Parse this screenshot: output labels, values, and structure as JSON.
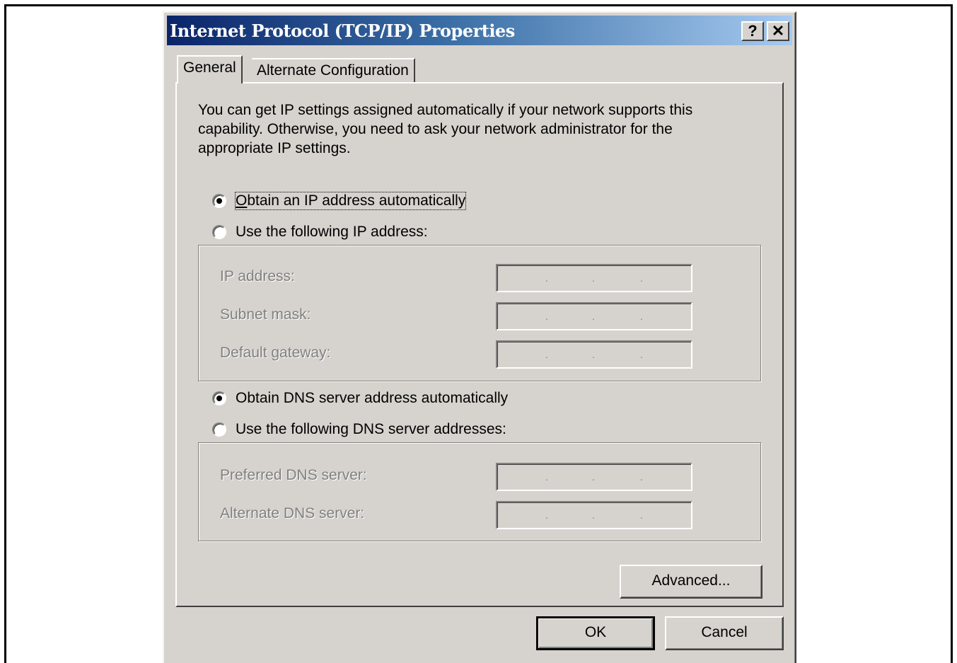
{
  "window": {
    "title": "Internet Protocol (TCP/IP) Properties",
    "help_button": "?",
    "close_button": "✕"
  },
  "tabs": [
    {
      "label": "General",
      "selected": true
    },
    {
      "label": "Alternate Configuration",
      "selected": false
    }
  ],
  "intro_text": "You can get IP settings assigned automatically if your network supports this capability. Otherwise, you need to ask your network administrator for the appropriate IP settings.",
  "ip_mode": {
    "auto": {
      "label": "Obtain an IP address automatically",
      "checked": true
    },
    "manual": {
      "label": "Use the following IP address:",
      "checked": false
    },
    "fields": [
      {
        "label": "IP address:",
        "value": ". . ."
      },
      {
        "label": "Subnet mask:",
        "value": ". . ."
      },
      {
        "label": "Default gateway:",
        "value": ". . ."
      }
    ]
  },
  "dns_mode": {
    "auto": {
      "label": "Obtain DNS server address automatically",
      "checked": true
    },
    "manual": {
      "label": "Use the following DNS server addresses:",
      "checked": false
    },
    "fields": [
      {
        "label": "Preferred DNS server:",
        "value": ". . ."
      },
      {
        "label": "Alternate DNS server:",
        "value": ". . ."
      }
    ]
  },
  "buttons": {
    "advanced": "Advanced...",
    "ok": "OK",
    "cancel": "Cancel"
  },
  "colors": {
    "dialog_bg": "#d6d3ce",
    "title_gradient_start": "#0a246a",
    "title_gradient_end": "#a6caf0",
    "disabled_text": "#808080"
  }
}
